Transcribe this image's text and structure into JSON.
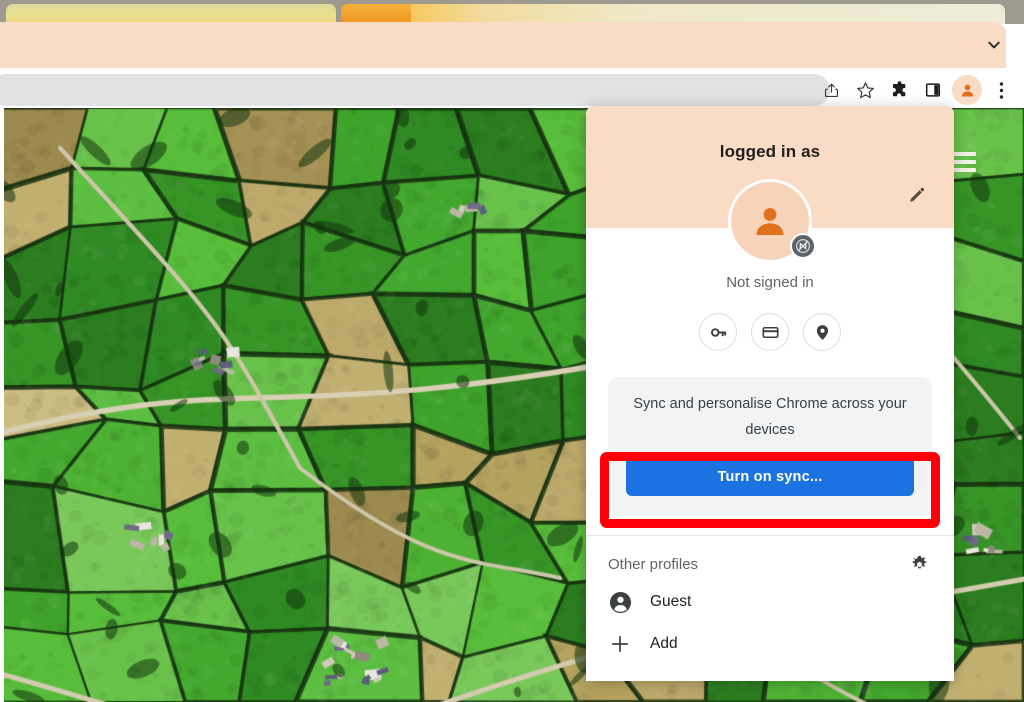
{
  "browser": {
    "tabstrip": {
      "tabs": [
        "",
        ""
      ]
    },
    "toolbar": {
      "share_icon": "share-icon",
      "bookmark_icon": "star-icon",
      "extensions_icon": "puzzle-icon",
      "side_panel_icon": "side-panel-icon",
      "profile_icon": "profile-avatar-icon",
      "menu_icon": "three-dot-menu-icon",
      "omnibox_value": "",
      "omnibox_placeholder": ""
    },
    "collapse_icon": "chevron-down-icon"
  },
  "page": {
    "hamburger_icon": "hamburger-menu-icon",
    "image_description": "aerial-photo-farmland"
  },
  "popup": {
    "title": "logged in as",
    "edit_icon": "pencil-icon",
    "avatar_icon": "person-icon",
    "sync_badge_icon": "sync-disabled-icon",
    "signin_status": "Not signed in",
    "quick_actions": [
      {
        "name": "passwords",
        "icon": "key-icon"
      },
      {
        "name": "payment-methods",
        "icon": "credit-card-icon"
      },
      {
        "name": "addresses",
        "icon": "location-pin-icon"
      }
    ],
    "sync_card": {
      "description": "Sync and personalise Chrome across your devices",
      "button_label": "Turn on sync...",
      "button_color": "#1b72e0"
    },
    "other_profiles": {
      "label": "Other profiles",
      "settings_icon": "gear-icon",
      "items": [
        {
          "label": "Guest",
          "icon": "person-circle-icon"
        },
        {
          "label": "Add",
          "icon": "plus-icon"
        }
      ]
    }
  },
  "annotation": {
    "highlight_color": "#fb0007",
    "target": "Turn on sync..."
  },
  "colors": {
    "peach": "#fadcc6",
    "accent_blue": "#1b72e0",
    "highlight_red": "#fb0007",
    "card_gray": "#f1f3f4"
  }
}
